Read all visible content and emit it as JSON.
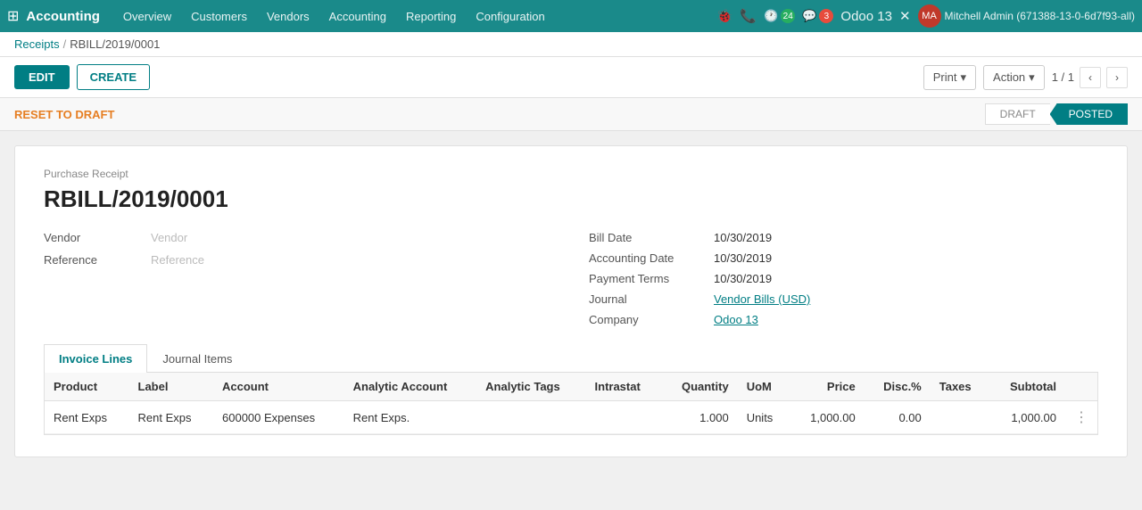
{
  "app": {
    "logo": "Accounting",
    "grid_icon": "⊞"
  },
  "topnav": {
    "items": [
      {
        "label": "Overview",
        "href": "#"
      },
      {
        "label": "Customers",
        "href": "#"
      },
      {
        "label": "Vendors",
        "href": "#"
      },
      {
        "label": "Accounting",
        "href": "#"
      },
      {
        "label": "Reporting",
        "href": "#"
      },
      {
        "label": "Configuration",
        "href": "#"
      }
    ],
    "notifications_count": "24",
    "messages_count": "3",
    "odoo_version": "Odoo 13",
    "user": "Mitchell Admin (671388-13-0-6d7f93-all)"
  },
  "breadcrumb": {
    "parent": "Receipts",
    "separator": "/",
    "current": "RBILL/2019/0001"
  },
  "toolbar": {
    "edit_label": "EDIT",
    "create_label": "CREATE",
    "print_label": "Print",
    "action_label": "Action",
    "pagination": "1 / 1"
  },
  "status_bar": {
    "reset_label": "RESET TO DRAFT",
    "steps": [
      {
        "label": "DRAFT",
        "active": false
      },
      {
        "label": "POSTED",
        "active": true
      }
    ]
  },
  "document": {
    "type": "Purchase Receipt",
    "number": "RBILL/2019/0001",
    "vendor_label": "Vendor",
    "vendor_value": "",
    "vendor_placeholder": "Vendor",
    "reference_label": "Reference",
    "reference_placeholder": "Reference",
    "bill_date_label": "Bill Date",
    "bill_date_value": "10/30/2019",
    "accounting_date_label": "Accounting Date",
    "accounting_date_value": "10/30/2019",
    "payment_terms_label": "Payment Terms",
    "payment_terms_value": "10/30/2019",
    "journal_label": "Journal",
    "journal_value": "Vendor Bills (USD)",
    "company_label": "Company",
    "company_value": "Odoo 13"
  },
  "tabs": [
    {
      "label": "Invoice Lines",
      "active": true
    },
    {
      "label": "Journal Items",
      "active": false
    }
  ],
  "table": {
    "columns": [
      {
        "label": "Product",
        "align": "left"
      },
      {
        "label": "Label",
        "align": "left"
      },
      {
        "label": "Account",
        "align": "left"
      },
      {
        "label": "Analytic Account",
        "align": "left"
      },
      {
        "label": "Analytic Tags",
        "align": "left"
      },
      {
        "label": "Intrastat",
        "align": "left"
      },
      {
        "label": "Quantity",
        "align": "right"
      },
      {
        "label": "UoM",
        "align": "left"
      },
      {
        "label": "Price",
        "align": "right"
      },
      {
        "label": "Disc.%",
        "align": "right"
      },
      {
        "label": "Taxes",
        "align": "left"
      },
      {
        "label": "Subtotal",
        "align": "right"
      }
    ],
    "rows": [
      {
        "product": "Rent Exps",
        "label": "Rent Exps",
        "account": "600000 Expenses",
        "analytic_account": "Rent Exps.",
        "analytic_tags": "",
        "intrastat": "",
        "quantity": "1.000",
        "uom": "Units",
        "price": "1,000.00",
        "disc": "0.00",
        "taxes": "",
        "subtotal": "1,000.00"
      }
    ]
  }
}
